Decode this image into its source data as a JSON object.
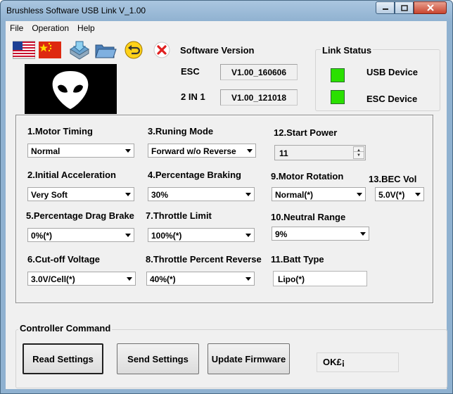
{
  "window": {
    "title": "Brushless Software USB Link V_1.00"
  },
  "menu": [
    "File",
    "Operation",
    "Help"
  ],
  "toolbar": [
    "flag-us-icon",
    "flag-cn-icon",
    "save-icon",
    "open-folder-icon",
    "undo-icon",
    "close-icon"
  ],
  "software_version": {
    "title": "Software Version",
    "esc_label": "ESC",
    "esc_value": "V1.00_160606",
    "twoinone_label": "2 IN 1",
    "twoinone_value": "V1.00_121018"
  },
  "link_status": {
    "title": "Link Status",
    "usb_label": "USB Device",
    "esc_label": "ESC Device",
    "led_color": "#2ae000"
  },
  "settings": {
    "motor_timing": {
      "label": "1.Motor Timing",
      "value": "Normal"
    },
    "initial_accel": {
      "label": "2.Initial Acceleration",
      "value": "Very Soft"
    },
    "run_mode": {
      "label": "3.Runing Mode",
      "value": "Forward w/o Reverse"
    },
    "pct_braking": {
      "label": "4.Percentage Braking",
      "value": "30%"
    },
    "pct_drag": {
      "label": "5.Percentage Drag Brake",
      "value": "0%(*)"
    },
    "cutoff": {
      "label": "6.Cut-off Voltage",
      "value": "3.0V/Cell(*)"
    },
    "throttle_limit": {
      "label": "7.Throttle Limit",
      "value": "100%(*)"
    },
    "throttle_reverse": {
      "label": "8.Throttle Percent Reverse",
      "value": "40%(*)"
    },
    "motor_rotation": {
      "label": "9.Motor Rotation",
      "value": "Normal(*)"
    },
    "neutral_range": {
      "label": "10.Neutral Range",
      "value": "9%"
    },
    "batt_type": {
      "label": "11.Batt Type",
      "value": "Lipo(*)"
    },
    "start_power": {
      "label": "12.Start Power",
      "value": "11"
    },
    "bec_vol": {
      "label": "13.BEC Vol",
      "value": "5.0V(*)"
    }
  },
  "commands": {
    "title": "Controller Command",
    "read": "Read Settings",
    "send": "Send Settings",
    "update": "Update Firmware",
    "status": "OK£¡"
  }
}
